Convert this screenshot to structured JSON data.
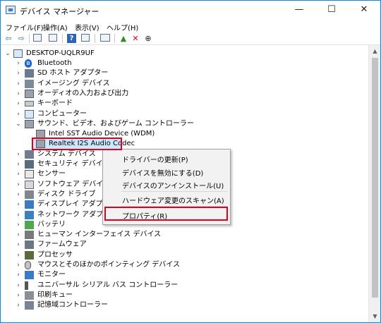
{
  "window": {
    "title": "デバイス マネージャー",
    "min": "—",
    "max": "☐",
    "close": "✕"
  },
  "menu": [
    "ファイル(F)",
    "操作(A)",
    "表示(V)",
    "ヘルプ(H)"
  ],
  "tree": {
    "root": "DESKTOP-UQLR9UF",
    "items": [
      {
        "label": "Bluetooth",
        "icon": "bluetooth-icon",
        "expanded": false
      },
      {
        "label": "SD ホスト アダプター",
        "icon": "sd-host-icon",
        "expanded": false
      },
      {
        "label": "イメージング デバイス",
        "icon": "camera-icon",
        "expanded": false
      },
      {
        "label": "オーディオの入力および出力",
        "icon": "speaker-icon",
        "expanded": false
      },
      {
        "label": "キーボード",
        "icon": "keyboard-icon",
        "expanded": false
      },
      {
        "label": "コンピューター",
        "icon": "computer-icon",
        "expanded": false
      },
      {
        "label": "サウンド、ビデオ、およびゲーム コントローラー",
        "icon": "sound-icon",
        "expanded": true
      },
      {
        "label": "Intel SST Audio Device (WDM)",
        "icon": "speaker-icon",
        "child": true
      },
      {
        "label": "Realtek I2S Audio Codec",
        "icon": "speaker-icon",
        "child": true,
        "selected": true
      },
      {
        "label": "システム デバイス",
        "icon": "system-icon",
        "expanded": false
      },
      {
        "label": "セキュリティ デバイス",
        "icon": "security-icon",
        "expanded": false
      },
      {
        "label": "センサー",
        "icon": "sensor-icon",
        "expanded": false
      },
      {
        "label": "ソフトウェア デバイス",
        "icon": "software-icon",
        "expanded": false
      },
      {
        "label": "ディスク ドライブ",
        "icon": "disk-icon",
        "expanded": false
      },
      {
        "label": "ディスプレイ アダプター",
        "icon": "display-icon",
        "expanded": false
      },
      {
        "label": "ネットワーク アダプター",
        "icon": "network-icon",
        "expanded": false
      },
      {
        "label": "バッテリ",
        "icon": "battery-icon",
        "expanded": false
      },
      {
        "label": "ヒューマン インターフェイス デバイス",
        "icon": "hid-icon",
        "expanded": false
      },
      {
        "label": "ファームウェア",
        "icon": "firmware-icon",
        "expanded": false
      },
      {
        "label": "プロセッサ",
        "icon": "processor-icon",
        "expanded": false
      },
      {
        "label": "マウスとそのほかのポインティング デバイス",
        "icon": "mouse-icon",
        "expanded": false
      },
      {
        "label": "モニター",
        "icon": "monitor-icon",
        "expanded": false
      },
      {
        "label": "ユニバーサル シリアル バス コントローラー",
        "icon": "usb-icon",
        "expanded": false
      },
      {
        "label": "印刷キュー",
        "icon": "printer-icon",
        "expanded": false
      },
      {
        "label": "記憶域コントローラー",
        "icon": "storage-icon",
        "expanded": false
      }
    ]
  },
  "context_menu": {
    "items": [
      "ドライバーの更新(P)",
      "デバイスを無効にする(D)",
      "デバイスのアンインストール(U)",
      "ハードウェア変更のスキャン(A)",
      "プロパティ(R)"
    ],
    "highlighted": "プロパティ(R)"
  },
  "colors": {
    "accent_border": "#1883d7",
    "highlight_red": "#e4001b",
    "selection": "#cce8ff"
  }
}
